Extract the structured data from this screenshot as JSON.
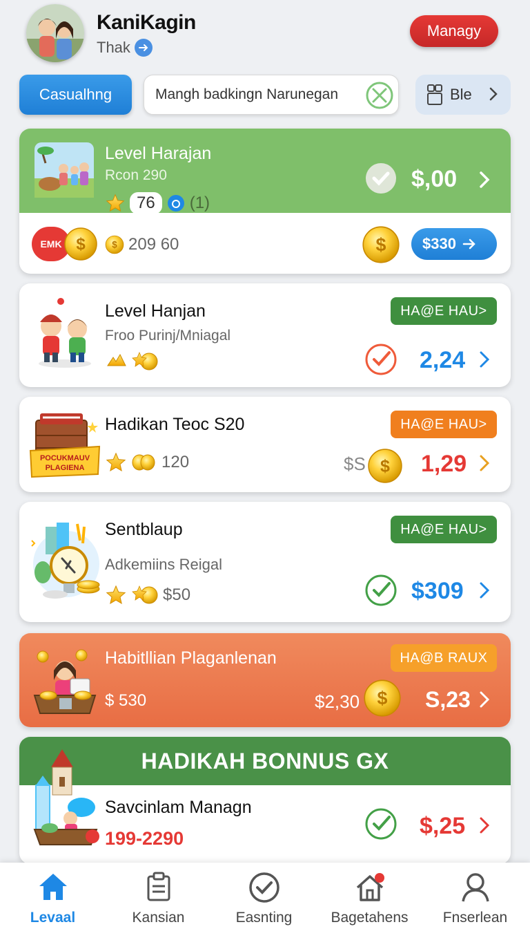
{
  "header": {
    "title": "KaniKagin",
    "subtitle": "Thak",
    "manage_label": "Managy"
  },
  "filters": {
    "category_label": "Casualhng",
    "search_value": "Mangh badkingn Narunegan",
    "view_label": "Ble"
  },
  "cards": [
    {
      "title": "Level Harajan",
      "subtitle": "Rcon 290",
      "rating": "76",
      "count": "(1)",
      "price": "$,00",
      "coins": "209 60",
      "badge": "EMK",
      "action": "$330",
      "header_color": "#7fbf6a"
    },
    {
      "title": "Level Hanjan",
      "subtitle": "Froo Purinj/Mniagal",
      "tag": "HA@E HAU>",
      "price": "2,24",
      "tag_color": "#3f8f3f",
      "price_color": "#1e88e5"
    },
    {
      "title": "Hadikan Teoc S20",
      "coins": "120",
      "tag": "HA@E HAU>",
      "price_prefix": "$S",
      "price": "1,29",
      "banner_line1": "POCUKMAUV",
      "banner_line2": "PLAGIENA",
      "tag_color": "#f07f1e",
      "price_color": "#e53935"
    },
    {
      "title": "Sentblaup",
      "subtitle": "Adkemiins Reigal",
      "coins": "$50",
      "tag": "HA@E HAU>",
      "price": "$309",
      "tag_color": "#3f8f3f",
      "price_color": "#1e88e5"
    },
    {
      "title": "Habitllian Plaganlenan",
      "coins": "$ 530",
      "tag": "HA@B RAUX",
      "price_prefix": "$2,30",
      "price": "S,23",
      "bg_color": "#ec7a53"
    },
    {
      "banner": "HADIKAH BONNUS GX",
      "title": "Savcinlam Managn",
      "range": "199-2290",
      "price": "$,25",
      "banner_color": "#4a9148",
      "price_color": "#e53935"
    }
  ],
  "nav": [
    {
      "label": "Levaal",
      "icon": "home-icon",
      "active": true
    },
    {
      "label": "Kansian",
      "icon": "clipboard-icon"
    },
    {
      "label": "Easnting",
      "icon": "check-circle-icon"
    },
    {
      "label": "Bagetahens",
      "icon": "house-notification-icon"
    },
    {
      "label": "Fnserlean",
      "icon": "user-icon"
    }
  ],
  "colors": {
    "accent_blue": "#1e88e5",
    "red": "#e53935",
    "green": "#43a047",
    "orange": "#f07f1e"
  }
}
